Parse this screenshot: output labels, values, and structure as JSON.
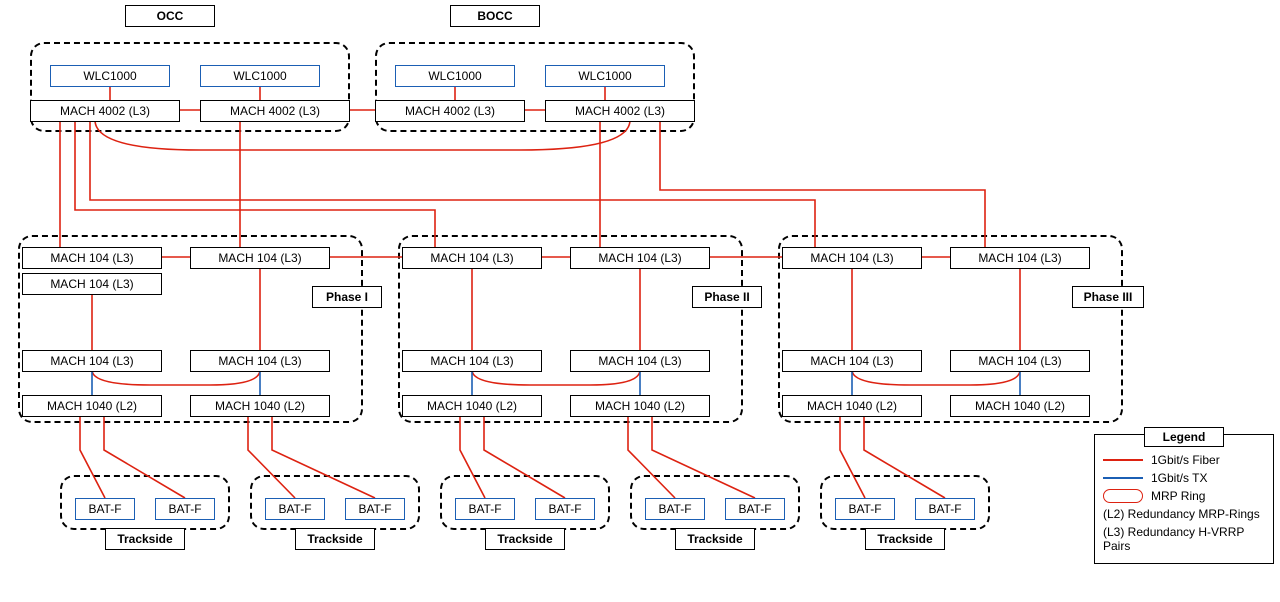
{
  "zones": {
    "occ": "OCC",
    "bocc": "BOCC",
    "phase1": "Phase I",
    "phase2": "Phase II",
    "phase3": "Phase III",
    "trackside": "Trackside"
  },
  "devices": {
    "wlc1000": "WLC1000",
    "mach4002_l3": "MACH 4002 (L3)",
    "mach104_l3": "MACH 104 (L3)",
    "mach1040_l2": "MACH 1040 (L2)",
    "batf": "BAT-F"
  },
  "legend": {
    "title": "Legend",
    "fiber": "1Gbit/s Fiber",
    "tx": "1Gbit/s TX",
    "mrp": "MRP Ring",
    "l2": "(L2) Redundancy MRP-Rings",
    "l3": "(L3) Redundancy H-VRRP Pairs"
  }
}
